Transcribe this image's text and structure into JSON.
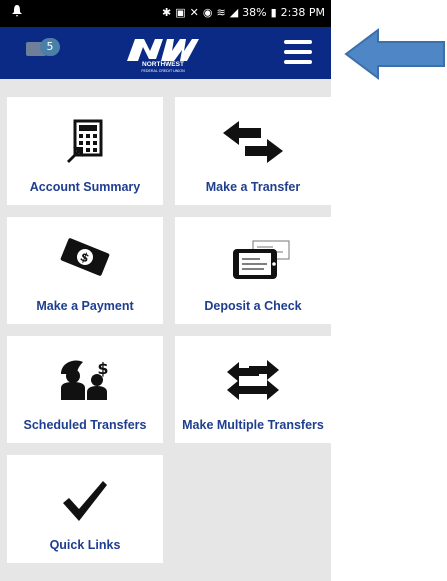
{
  "status_bar": {
    "time": "2:38 PM",
    "battery": "38%"
  },
  "header": {
    "mail_count": "5",
    "logo_line1": "NORTHWEST",
    "logo_line2": "FEDERAL CREDIT UNION"
  },
  "tiles": [
    {
      "label": "Account Summary",
      "icon": "calculator-icon"
    },
    {
      "label": "Make a Transfer",
      "icon": "transfer-arrows-icon"
    },
    {
      "label": "Make a Payment",
      "icon": "money-icon"
    },
    {
      "label": "Deposit a Check",
      "icon": "mobile-deposit-icon"
    },
    {
      "label": "Scheduled Transfers",
      "icon": "people-icon"
    },
    {
      "label": "Make Multiple Transfers",
      "icon": "multi-transfer-icon"
    },
    {
      "label": "Quick Links",
      "icon": "checkmark-icon"
    }
  ],
  "colors": {
    "brand": "#0a2a86",
    "label": "#1f3e8f",
    "arrow": "#4f86c6"
  }
}
